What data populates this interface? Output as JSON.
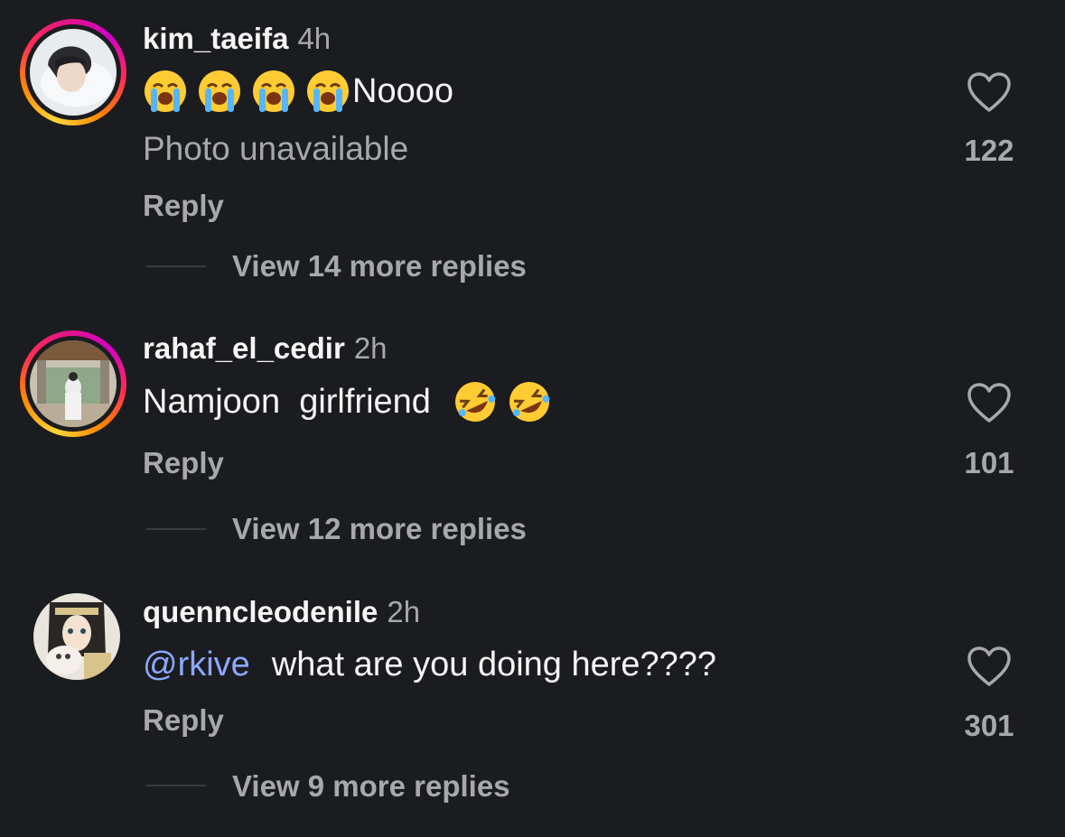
{
  "comments": [
    {
      "username": "kim_taeifa",
      "time": "4h",
      "text": "Noooo",
      "emojis": [
        "loudly-crying-face",
        "loudly-crying-face",
        "loudly-crying-face",
        "loudly-crying-face"
      ],
      "attachment": "Photo unavailable",
      "reply": "Reply",
      "view_more": "View 14 more replies",
      "likes": "122",
      "story_ring": true
    },
    {
      "username": "rahaf_el_cedir",
      "time": "2h",
      "text": "Namjoon  girlfriend",
      "emojis": [
        "rolling-on-floor-laughing",
        "rolling-on-floor-laughing"
      ],
      "reply": "Reply",
      "view_more": "View 12 more replies",
      "likes": "101",
      "story_ring": true
    },
    {
      "username": "quenncleodenile",
      "time": "2h",
      "mention": "@rkive",
      "text": "what are you doing here????",
      "reply": "Reply",
      "view_more": "View 9 more replies",
      "likes": "301",
      "story_ring": false
    }
  ],
  "colors": {
    "background": "#1b1c1f",
    "text_primary": "#f5f5f5",
    "text_secondary": "#a7a8ac",
    "mention": "#8ca8ff"
  }
}
